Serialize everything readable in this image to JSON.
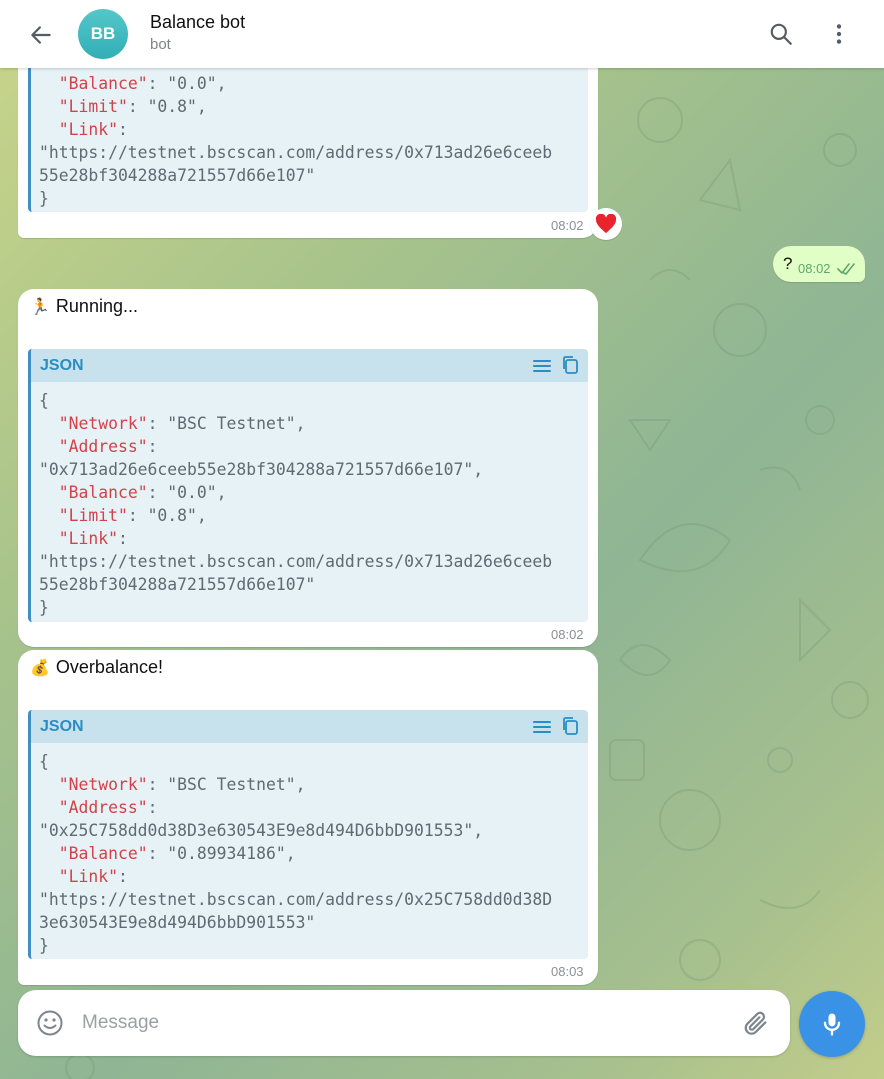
{
  "header": {
    "avatar_initials": "BB",
    "title": "Balance bot",
    "subtitle": "bot"
  },
  "messages": [
    {
      "partial_code_lines": [
        [
          "  ",
          "\"Balance\"",
          ": \"0.0\","
        ],
        [
          "  ",
          "\"Limit\"",
          ": \"0.8\","
        ],
        [
          "  ",
          "\"Link\"",
          ":"
        ],
        [
          "\"https://testnet.bscscan.com/address/0x713ad26e6ceeb",
          "",
          ""
        ],
        [
          "55e28bf304288a721557d66e107\"",
          "",
          ""
        ],
        [
          "}",
          "",
          ""
        ]
      ],
      "time": "08:02",
      "reaction": "❤️"
    },
    {
      "text": "? ",
      "time": "08:02"
    },
    {
      "icon": "🏃",
      "text": "Running...",
      "code_lang": "JSON",
      "code_lines": [
        [
          "{",
          "",
          ""
        ],
        [
          "  ",
          "\"Network\"",
          ": \"BSC Testnet\","
        ],
        [
          "  ",
          "\"Address\"",
          ":"
        ],
        [
          "\"0x713ad26e6ceeb55e28bf304288a721557d66e107\",",
          "",
          ""
        ],
        [
          "  ",
          "\"Balance\"",
          ": \"0.0\","
        ],
        [
          "  ",
          "\"Limit\"",
          ": \"0.8\","
        ],
        [
          "  ",
          "\"Link\"",
          ":"
        ],
        [
          "\"https://testnet.bscscan.com/address/0x713ad26e6ceeb",
          "",
          ""
        ],
        [
          "55e28bf304288a721557d66e107\"",
          "",
          ""
        ],
        [
          "}",
          "",
          ""
        ]
      ],
      "time": "08:02"
    },
    {
      "icon": "💰",
      "text": "Overbalance!",
      "code_lang": "JSON",
      "code_lines": [
        [
          "{",
          "",
          ""
        ],
        [
          "  ",
          "\"Network\"",
          ": \"BSC Testnet\","
        ],
        [
          "  ",
          "\"Address\"",
          ":"
        ],
        [
          "\"0x25C758dd0d38D3e630543E9e8d494D6bbD901553\",",
          "",
          ""
        ],
        [
          "  ",
          "\"Balance\"",
          ": \"0.89934186\","
        ],
        [
          "  ",
          "\"Link\"",
          ":"
        ],
        [
          "\"https://testnet.bscscan.com/address/0x25C758dd0d38D",
          "",
          ""
        ],
        [
          "3e630543E9e8d494D6bbD901553\"",
          "",
          ""
        ],
        [
          "}",
          "",
          ""
        ]
      ],
      "time": "08:03"
    }
  ],
  "composer": {
    "placeholder": "Message"
  },
  "colors": {
    "accent": "#3a92e6",
    "code_key": "#d2424b",
    "code_header": "#c7e2ec",
    "outgoing_bubble": "#e1fec6"
  },
  "icons": {
    "back": "arrow-left-icon",
    "search": "search-icon",
    "more": "more-vertical-icon",
    "emoji": "smile-icon",
    "attach": "paperclip-icon",
    "mic": "microphone-icon",
    "wrap": "wrap-lines-icon",
    "copy": "copy-icon",
    "read": "double-check-icon",
    "reaction": "heart-icon"
  }
}
